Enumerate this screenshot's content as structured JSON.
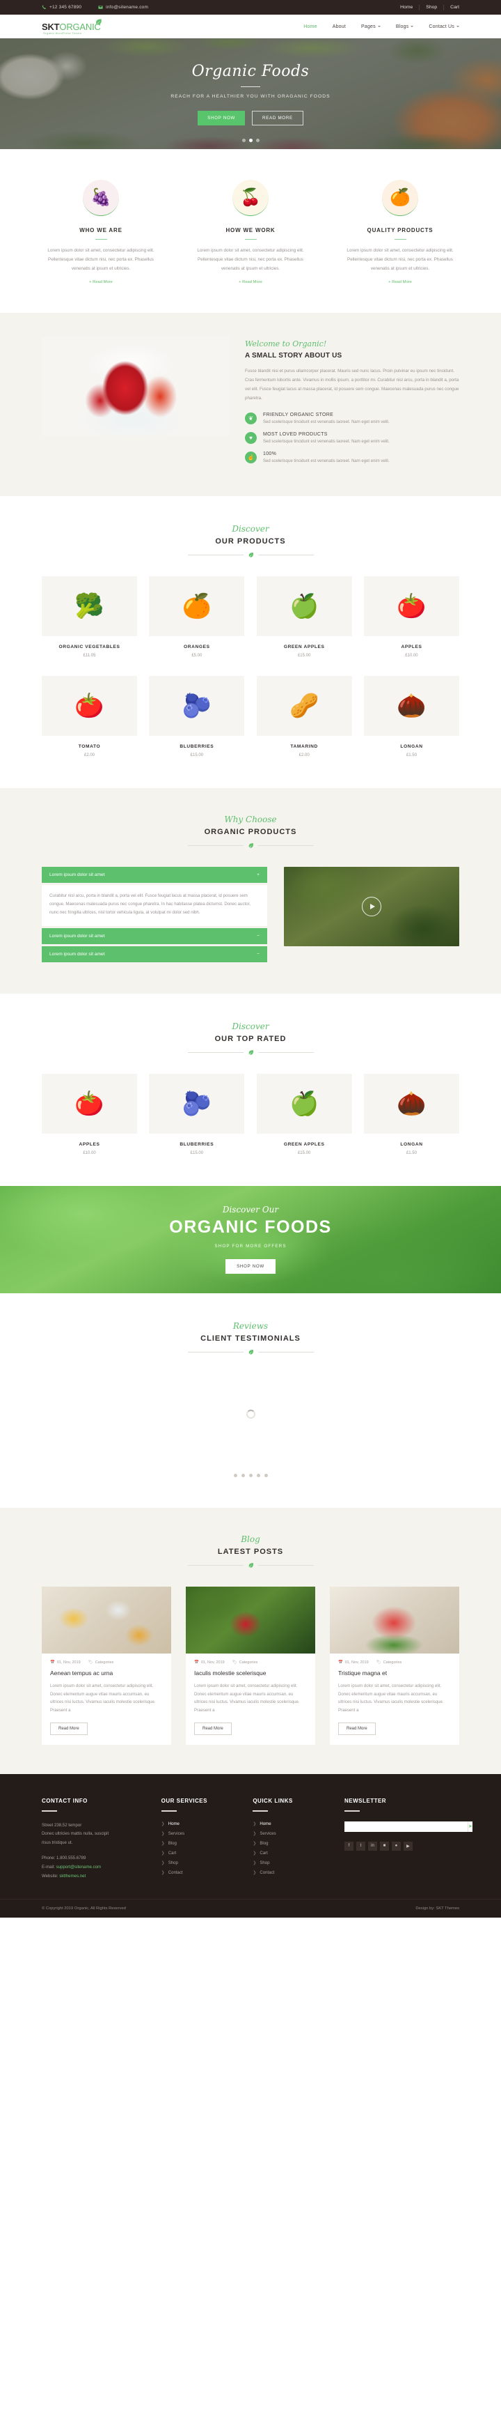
{
  "topbar": {
    "phone": "+12 345 67890",
    "email": "info@sitename.com",
    "links": [
      "Home",
      "Shop",
      "Cart"
    ]
  },
  "header": {
    "logo_main": "SKT",
    "logo_accent": "ORGANIC",
    "logo_tagline": "Organic WordPress Theme",
    "nav": [
      {
        "label": "Home",
        "caret": false
      },
      {
        "label": "About",
        "caret": false
      },
      {
        "label": "Pages",
        "caret": true
      },
      {
        "label": "Blogs",
        "caret": true
      },
      {
        "label": "Contact Us",
        "caret": true
      }
    ]
  },
  "hero": {
    "title": "Organic Foods",
    "subtitle": "REACH FOR A HEALTHIER YOU WITH ORAGANIC FOODS",
    "primary_button": "SHOP NOW",
    "secondary_button": "READ MORE",
    "slides": 3,
    "active_slide": 1
  },
  "features": [
    {
      "icon": "grapes-icon",
      "emoji": "🍇",
      "bg": "#faeff0",
      "title": "WHO WE ARE",
      "text": "Lorem ipsum dolor sit amet, consectetur adipiscing elit. Pellentesque vitae dictum nisi, nec porta ex. Phasellus venenatis at ipsum et ultricies.",
      "link": "+ Read More"
    },
    {
      "icon": "cherries-icon",
      "emoji": "🍒",
      "bg": "#fbf6e6",
      "title": "HOW WE WORK",
      "text": "Lorem ipsum dolor sit amet, consectetur adipiscing elit. Pellentesque vitae dictum nisi, nec porta ex. Phasellus venenatis at ipsum et ultricies.",
      "link": "+ Read More"
    },
    {
      "icon": "orange-icon",
      "emoji": "🍊",
      "bg": "#fdf1e3",
      "title": "QUALITY PRODUCTS",
      "text": "Lorem ipsum dolor sit amet, consectetur adipiscing elit. Pellentesque vitae dictum nisi, nec porta ex. Phasellus venenatis at ipsum et ultricies.",
      "link": "+ Read More"
    }
  ],
  "about": {
    "script": "Welcome to Organic!",
    "heading": "A SMALL STORY ABOUT US",
    "paragraph": "Fusce blandit nisi et purus ullamcorper placerat. Mauris sed nunc lacus. Proin pulvinar eu ipsum nec tincidunt. Cras fermentum lobortis ante. Vivamus in mollis ipsum, a porttitor mi. Curabitur nisl arcu, porta in blandit a, porta vel elit. Fusce feugiat lacus at massa placerat, id posuere sem congue. Maecenas malesuada purus nec congue pharetra.",
    "items": [
      {
        "icon": "leaf-icon",
        "glyph": "❦",
        "title": "FRIENDLY ORGANIC STORE",
        "text": "Sed scelerisque tincidunt est venenatis laoreet. Nam eget enim velit."
      },
      {
        "icon": "heart-icon",
        "glyph": "♥",
        "title": "MOST LOVED PRODUCTS",
        "text": "Sed scelerisque tincidunt est venenatis laoreet. Nam eget enim velit."
      },
      {
        "icon": "thumbs-up-icon",
        "glyph": "☝",
        "title": "100%",
        "text": "Sed scelerisque tincidunt est venenatis laoreet. Nam eget enim velit."
      }
    ]
  },
  "products_section": {
    "script": "Discover",
    "title": "OUR PRODUCTS",
    "rows": [
      [
        {
          "name": "ORGANIC VEGETABLES",
          "price": "£11.05",
          "emoji": "🥦"
        },
        {
          "name": "ORANGES",
          "price": "£5.00",
          "emoji": "🍊"
        },
        {
          "name": "GREEN APPLES",
          "price": "£15.00",
          "emoji": "🍏"
        },
        {
          "name": "APPLES",
          "price": "£10.00",
          "emoji": "🍅"
        }
      ],
      [
        {
          "name": "TOMATO",
          "price": "£2.00",
          "emoji": "🍅"
        },
        {
          "name": "BLUBERRIES",
          "price": "£15.00",
          "emoji": "🫐"
        },
        {
          "name": "TAMARIND",
          "price": "£2.00",
          "emoji": "🥜"
        },
        {
          "name": "LONGAN",
          "price": "£1.50",
          "emoji": "🌰"
        }
      ]
    ]
  },
  "why": {
    "script": "Why Choose",
    "title": "ORGANIC PRODUCTS",
    "accordion": [
      {
        "label": "Lorem ipsum dolor sit amet",
        "sign": "+",
        "open": true,
        "body": "Curabitur nisl arcu, porta in blandit a, porta vel elit. Fusce feugiat lacus at massa placerat, id posuere sem congue. Maecenas malesuada purus nec congue pharetra. In hac habitasse platea dictumst. Donec auctor, nunc nec fringilla ultrices, nisl tortor vehicula ligula, at volutpat mi dolor sed nibh."
      },
      {
        "label": "Lorem ipsum dolor sit amet",
        "sign": "−",
        "open": false,
        "body": ""
      },
      {
        "label": "Lorem ipsum dolor sit amet",
        "sign": "−",
        "open": false,
        "body": ""
      }
    ],
    "video_icon": "play-icon"
  },
  "top_rated": {
    "script": "Discover",
    "title": "OUR TOP RATED",
    "items": [
      {
        "name": "APPLES",
        "price": "£10.00",
        "emoji": "🍅"
      },
      {
        "name": "BLUBERRIES",
        "price": "£15.00",
        "emoji": "🫐"
      },
      {
        "name": "GREEN APPLES",
        "price": "£15.00",
        "emoji": "🍏"
      },
      {
        "name": "LONGAN",
        "price": "£1.50",
        "emoji": "🌰"
      }
    ]
  },
  "cta": {
    "script": "Discover Our",
    "title": "ORGANIC FOODS",
    "subtitle": "SHOP FOR MORE OFFERS",
    "button": "SHOP NOW"
  },
  "testimonials": {
    "script": "Reviews",
    "title": "CLIENT TESTIMONIALS",
    "dots": 5
  },
  "blog": {
    "script": "Blog",
    "title": "LATEST POSTS",
    "posts": [
      {
        "date": "01, Nov, 2019",
        "category": "Categories",
        "title": "Aenean tempus ac urna",
        "excerpt": "Lorem ipsum dolor sit amet, consectetur adipiscing elit. Donec elementum augue vitae mauris accumsan, eu ultrices nisi luctus. Vivamus iaculis molestie scelerisque. Praesent a",
        "button": "Read More"
      },
      {
        "date": "01, Nov, 2019",
        "category": "Categories",
        "title": "Iaculis molestie scelerisque",
        "excerpt": "Lorem ipsum dolor sit amet, consectetur adipiscing elit. Donec elementum augue vitae mauris accumsan, eu ultrices nisi luctus. Vivamus iaculis molestie scelerisque. Praesent a",
        "button": "Read More"
      },
      {
        "date": "01, Nov, 2019",
        "category": "Categories",
        "title": "Tristique magna et",
        "excerpt": "Lorem ipsum dolor sit amet, consectetur adipiscing elit. Donec elementum augue vitae mauris accumsan, eu ultrices nisi luctus. Vivamus iaculis molestie scelerisque. Praesent a",
        "button": "Read More"
      }
    ]
  },
  "footer": {
    "contact": {
      "heading": "CONTACT INFO",
      "address1": "Street 238,52 tempor",
      "address2": "Donec ultricies mattis nulla, suscipit",
      "address3": "risus tristique ut.",
      "phone_label": "Phone: 1.800.555.6789",
      "email_label": "E-mail:",
      "email_value": "support@sitename.com",
      "website_label": "Website:",
      "website_value": "sktthemes.net"
    },
    "services": {
      "heading": "OUR SERVICES",
      "items": [
        "Home",
        "Services",
        "Blog",
        "Cart",
        "Shop",
        "Contact"
      ]
    },
    "quick": {
      "heading": "QUICK LINKS",
      "items": [
        "Home",
        "Services",
        "Blog",
        "Cart",
        "Shop",
        "Contact"
      ]
    },
    "newsletter": {
      "heading": "NEWSLETTER",
      "placeholder": "",
      "send_icon": "paper-plane-icon",
      "socials": [
        "f",
        "t",
        "in",
        "■",
        "●",
        "⚑"
      ]
    },
    "copyright": "© Copyright 2019 Organic, All Rights Reserved",
    "design_by": "Design by: SKT Themes"
  },
  "colors": {
    "accent": "#5cc06d",
    "dark": "#231c19",
    "cream": "#f4f3ee"
  }
}
